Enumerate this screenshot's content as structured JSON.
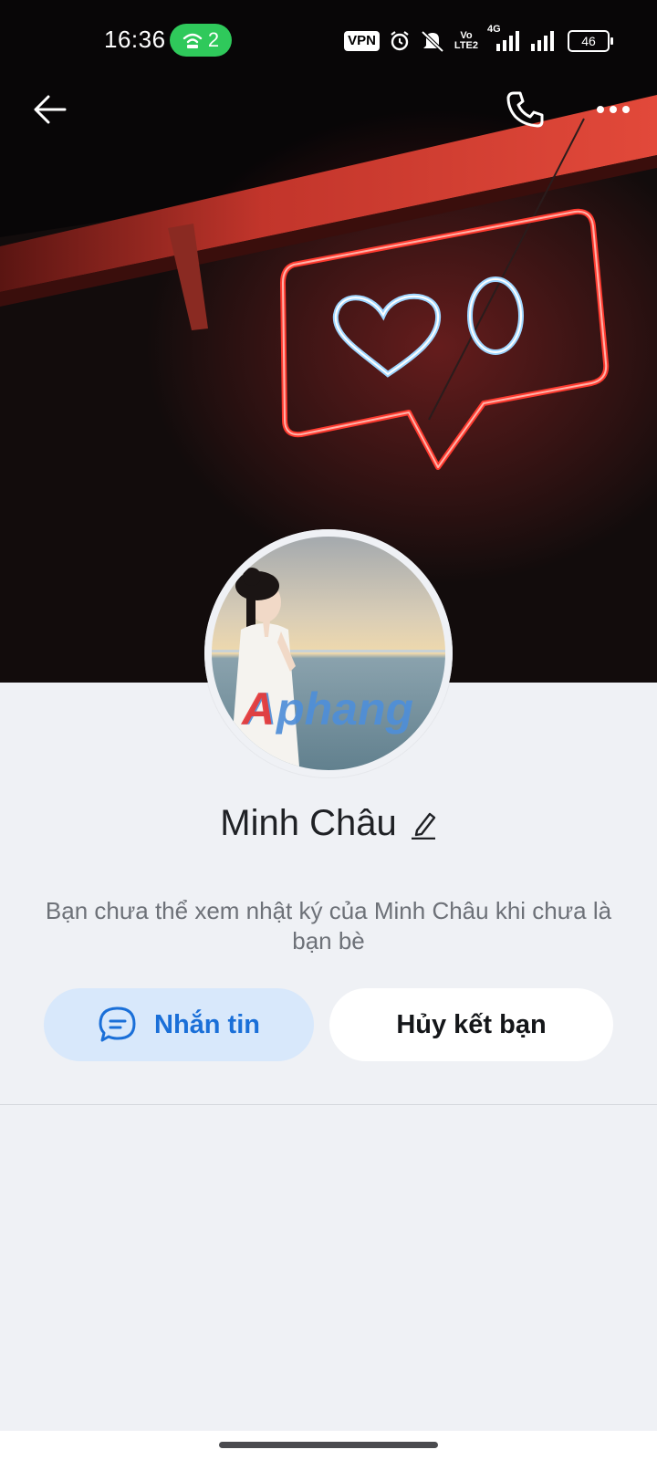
{
  "status_bar": {
    "time": "16:36",
    "hotspot_count": "2",
    "vpn_label": "VPN",
    "volte_label_top": "Vo",
    "volte_label_bottom": "LTE2",
    "network_label": "4G",
    "battery_level": "46"
  },
  "cover": {
    "neon_counter": "0"
  },
  "avatar": {
    "watermark": "Aphang"
  },
  "profile": {
    "name": "Minh Châu",
    "privacy_note": "Bạn chưa thể xem nhật ký của Minh Châu khi chưa là bạn bè"
  },
  "actions": {
    "message_label": "Nhắn tin",
    "unfriend_label": "Hủy kết bạn"
  },
  "colors": {
    "accent": "#1a6fd8",
    "message_button_bg": "#d8e8fb",
    "page_bg": "#eff1f5",
    "hotspot_green": "#2fc95b"
  },
  "icons": {
    "back": "arrow-left-icon",
    "call": "phone-icon",
    "more": "more-dots-icon",
    "edit": "pencil-icon",
    "message": "chat-bubble-icon"
  }
}
